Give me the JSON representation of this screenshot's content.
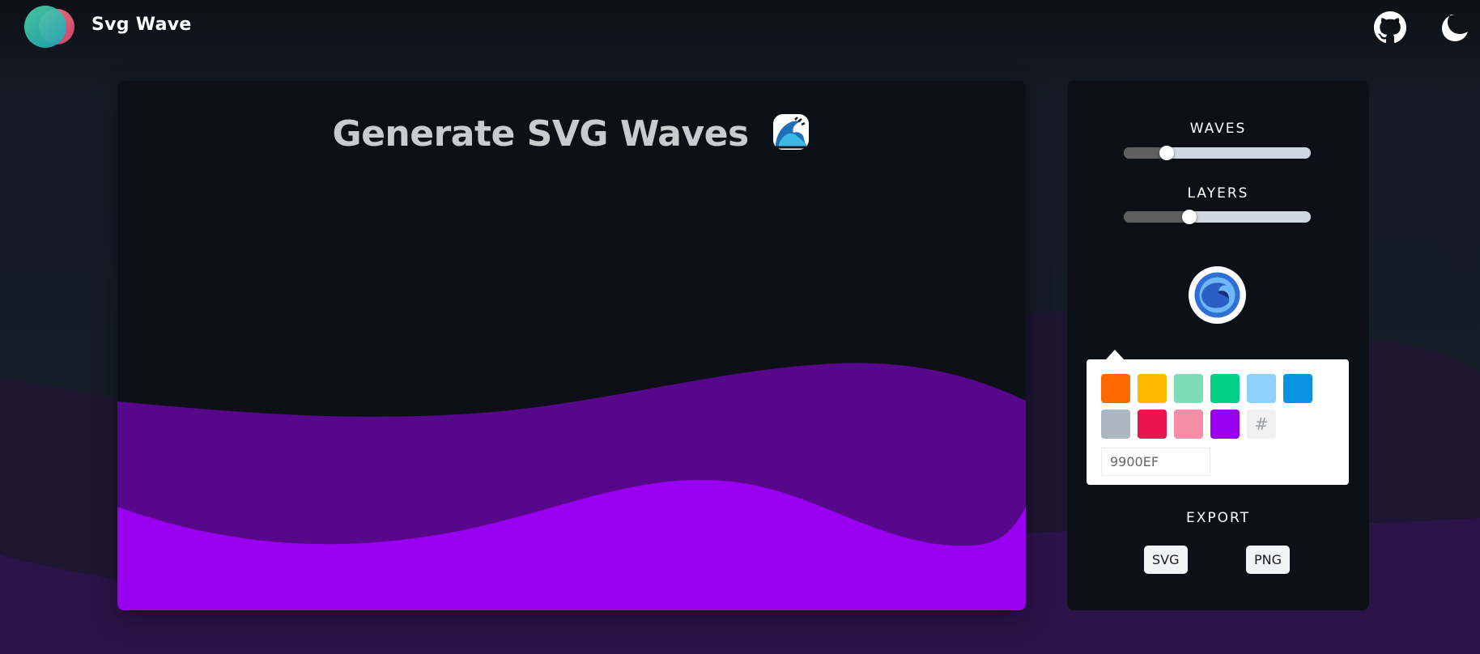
{
  "header": {
    "brand": "Svg Wave",
    "icons": [
      "logo-icon",
      "github-icon",
      "moon-icon"
    ]
  },
  "editor": {
    "title": "Generate SVG Waves",
    "title_emoji": "wave-emoji-icon"
  },
  "controls": {
    "waves_label": "WAVES",
    "waves_level": 0.23,
    "layers_label": "LAYERS",
    "layers_level": 0.35,
    "color_toggle_icon": "wave-palette-icon"
  },
  "color_picker": {
    "swatches": [
      "#FF6900",
      "#FCB900",
      "#7BDCB5",
      "#00D084",
      "#8ED1FC",
      "#0693E3",
      "#ABB8C3",
      "#EB144C",
      "#F78DA7",
      "#9900EF"
    ],
    "hash_symbol": "#",
    "hex_value": "9900EF"
  },
  "export": {
    "label": "EXPORT",
    "svg_label": "SVG",
    "png_label": "PNG"
  },
  "colors": {
    "wave_primary": "#9900EF",
    "wave_dark": "#57078A",
    "background_wave": "#241538",
    "panel": "#0D1117"
  }
}
